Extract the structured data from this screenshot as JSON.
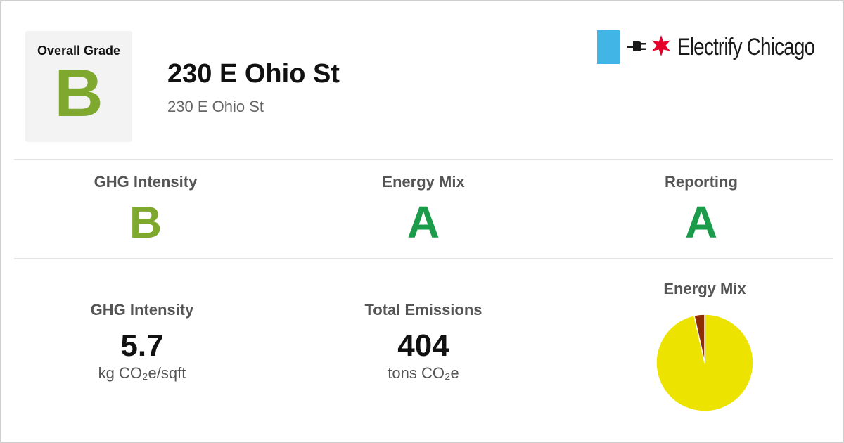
{
  "overall": {
    "label": "Overall Grade",
    "grade": "B",
    "grade_color": "#7fa82e"
  },
  "building": {
    "name": "230 E Ohio St",
    "address": "230 E Ohio St"
  },
  "brand": {
    "name": "Electrify Chicago",
    "flag_color": "#41b6e6",
    "star_color": "#e4002b"
  },
  "grades": [
    {
      "label": "GHG Intensity",
      "grade": "B"
    },
    {
      "label": "Energy Mix",
      "grade": "A"
    },
    {
      "label": "Reporting",
      "grade": "A"
    }
  ],
  "metrics": {
    "ghg": {
      "label": "GHG Intensity",
      "value": "5.7",
      "unit": "kg CO₂e/sqft"
    },
    "emissions": {
      "label": "Total Emissions",
      "value": "404",
      "unit": "tons CO₂e"
    }
  },
  "chart_data": {
    "type": "pie",
    "title": "Energy Mix",
    "slices": [
      {
        "value": 0.965,
        "color": "#ede300"
      },
      {
        "value": 0.035,
        "color": "#8c2d04"
      }
    ]
  }
}
